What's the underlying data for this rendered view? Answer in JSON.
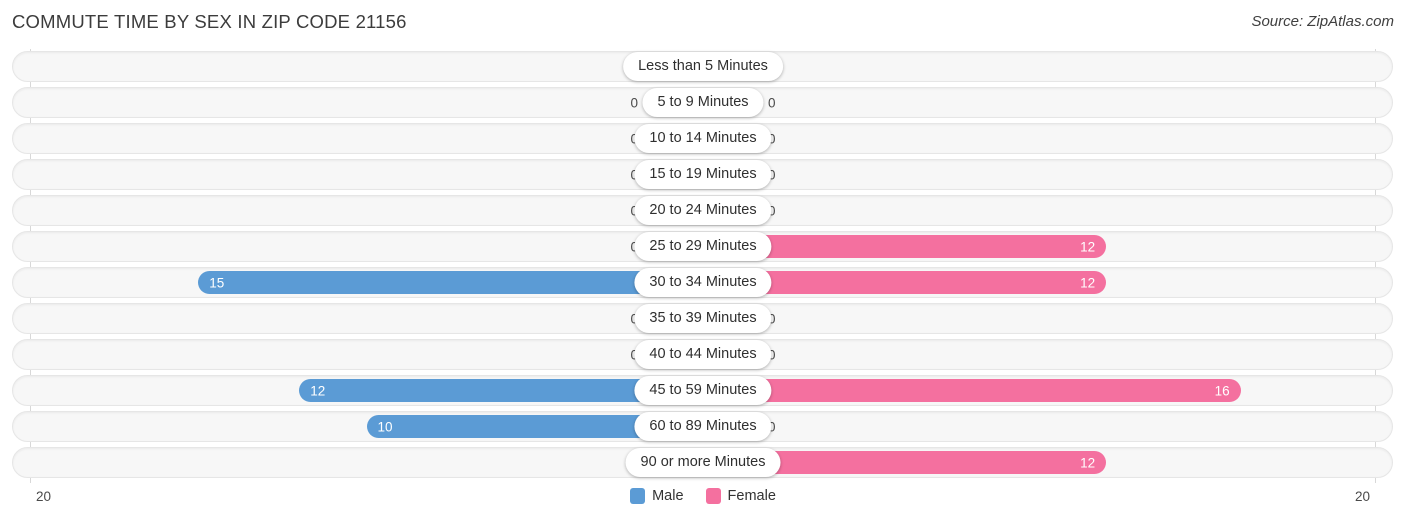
{
  "header": {
    "title": "COMMUTE TIME BY SEX IN ZIP CODE 21156",
    "source": "Source: ZipAtlas.com"
  },
  "axis": {
    "left_label": "20",
    "right_label": "20"
  },
  "legend": {
    "items": [
      {
        "label": "Male",
        "color": "#5b9bd5"
      },
      {
        "label": "Female",
        "color": "#f4709f"
      }
    ]
  },
  "colors": {
    "male": "#5b9bd5",
    "male_zero": "#a8c8e8",
    "female": "#f4709f",
    "female_zero": "#f5a6c3",
    "track": "#f7f7f7",
    "gridline": "#d8d8d8"
  },
  "chart_data": {
    "type": "bar",
    "title": "COMMUTE TIME BY SEX IN ZIP CODE 21156",
    "subtitle": "Source: ZipAtlas.com",
    "orientation": "horizontal",
    "layout": "diverging-bidirectional",
    "xlabel": "",
    "ylabel": "",
    "xlim": [
      20,
      20
    ],
    "axis_max": 20,
    "grid": true,
    "legend_position": "bottom-center",
    "categories": [
      "Less than 5 Minutes",
      "5 to 9 Minutes",
      "10 to 14 Minutes",
      "15 to 19 Minutes",
      "20 to 24 Minutes",
      "25 to 29 Minutes",
      "30 to 34 Minutes",
      "35 to 39 Minutes",
      "40 to 44 Minutes",
      "45 to 59 Minutes",
      "60 to 89 Minutes",
      "90 or more Minutes"
    ],
    "series": [
      {
        "name": "Male",
        "values": [
          0,
          0,
          0,
          0,
          0,
          0,
          15,
          0,
          0,
          12,
          10,
          0
        ]
      },
      {
        "name": "Female",
        "values": [
          0,
          0,
          0,
          0,
          0,
          12,
          12,
          0,
          0,
          16,
          0,
          12
        ]
      }
    ]
  },
  "rows": [
    {
      "label": "Less than 5 Minutes",
      "male": 0,
      "female": 0,
      "male_text": "0",
      "female_text": "0"
    },
    {
      "label": "5 to 9 Minutes",
      "male": 0,
      "female": 0,
      "male_text": "0",
      "female_text": "0"
    },
    {
      "label": "10 to 14 Minutes",
      "male": 0,
      "female": 0,
      "male_text": "0",
      "female_text": "0"
    },
    {
      "label": "15 to 19 Minutes",
      "male": 0,
      "female": 0,
      "male_text": "0",
      "female_text": "0"
    },
    {
      "label": "20 to 24 Minutes",
      "male": 0,
      "female": 0,
      "male_text": "0",
      "female_text": "0"
    },
    {
      "label": "25 to 29 Minutes",
      "male": 0,
      "female": 12,
      "male_text": "0",
      "female_text": "12"
    },
    {
      "label": "30 to 34 Minutes",
      "male": 15,
      "female": 12,
      "male_text": "15",
      "female_text": "12"
    },
    {
      "label": "35 to 39 Minutes",
      "male": 0,
      "female": 0,
      "male_text": "0",
      "female_text": "0"
    },
    {
      "label": "40 to 44 Minutes",
      "male": 0,
      "female": 0,
      "male_text": "0",
      "female_text": "0"
    },
    {
      "label": "45 to 59 Minutes",
      "male": 12,
      "female": 16,
      "male_text": "12",
      "female_text": "16"
    },
    {
      "label": "60 to 89 Minutes",
      "male": 10,
      "female": 0,
      "male_text": "10",
      "female_text": "0"
    },
    {
      "label": "90 or more Minutes",
      "male": 0,
      "female": 12,
      "male_text": "0",
      "female_text": "12"
    }
  ]
}
